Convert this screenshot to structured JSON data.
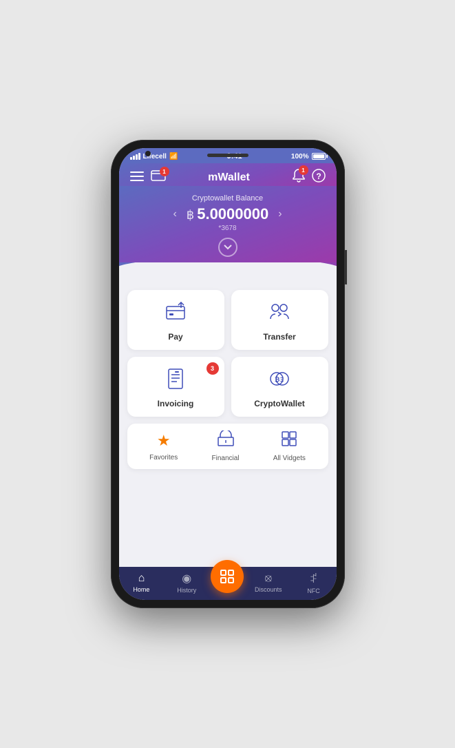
{
  "phone": {
    "status_bar": {
      "carrier": "Lifecell",
      "wifi": "WiFi",
      "time": "9:41",
      "battery": "100%"
    },
    "header": {
      "title": "mWallet",
      "menu_label": "menu",
      "card_label": "cards",
      "notification_label": "notifications",
      "help_label": "help",
      "notification_badge": "1"
    },
    "balance": {
      "label": "Cryptowallet Balance",
      "currency_symbol": "฿",
      "amount": "5.0000000",
      "account": "*3678",
      "nav_left": "‹",
      "nav_right": "›"
    },
    "cards": [
      {
        "id": "pay",
        "label": "Pay",
        "badge": null
      },
      {
        "id": "transfer",
        "label": "Transfer",
        "badge": null
      },
      {
        "id": "invoicing",
        "label": "Invoicing",
        "badge": "3"
      },
      {
        "id": "cryptowallet",
        "label": "CryptoWallet",
        "badge": null
      }
    ],
    "widgets": [
      {
        "id": "favorites",
        "label": "Favorites"
      },
      {
        "id": "financial",
        "label": "Financial"
      },
      {
        "id": "all-vidgets",
        "label": "All Vidgets"
      }
    ],
    "bottom_nav": [
      {
        "id": "home",
        "label": "Home",
        "active": true
      },
      {
        "id": "history",
        "label": "History",
        "active": false
      },
      {
        "id": "scan",
        "label": "",
        "active": false,
        "is_scan": true
      },
      {
        "id": "discounts",
        "label": "Discounts",
        "active": false
      },
      {
        "id": "nfc",
        "label": "NFC",
        "active": false
      }
    ]
  }
}
